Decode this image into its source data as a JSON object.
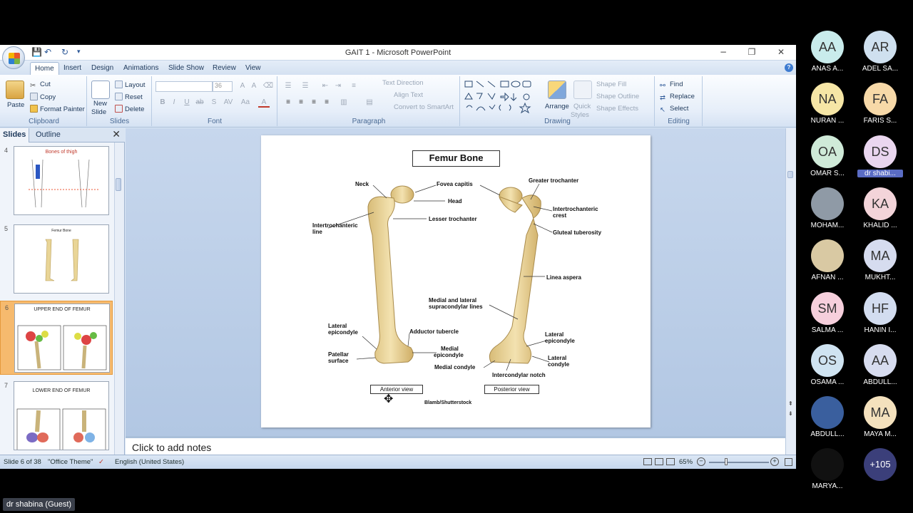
{
  "window": {
    "title": "GAIT 1 - Microsoft PowerPoint",
    "minimize": "−",
    "restore": "❐",
    "close": "✕"
  },
  "qat": {
    "save": "💾",
    "undo": "↶",
    "redo": "↻",
    "more": "▾"
  },
  "tabs": [
    "Home",
    "Insert",
    "Design",
    "Animations",
    "Slide Show",
    "Review",
    "View"
  ],
  "ribbon": {
    "clipboard": {
      "label": "Clipboard",
      "paste": "Paste",
      "cut": "Cut",
      "copy": "Copy",
      "format_painter": "Format Painter"
    },
    "slides": {
      "label": "Slides",
      "new_slide": "New",
      "new_slide2": "Slide",
      "layout": "Layout",
      "reset": "Reset",
      "delete": "Delete"
    },
    "font": {
      "label": "Font",
      "font_size": "36"
    },
    "paragraph": {
      "label": "Paragraph",
      "text_direction": "Text Direction",
      "align_text": "Align Text",
      "convert": "Convert to SmartArt"
    },
    "drawing": {
      "label": "Drawing",
      "arrange": "Arrange",
      "quick_styles": "Quick",
      "quick_styles2": "Styles",
      "shape_fill": "Shape Fill",
      "shape_outline": "Shape Outline",
      "shape_effects": "Shape Effects"
    },
    "editing": {
      "label": "Editing",
      "find": "Find",
      "replace": "Replace",
      "select": "Select"
    }
  },
  "panel": {
    "tab_slides": "Slides",
    "tab_outline": "Outline",
    "close": "✕",
    "thumbs": [
      {
        "num": "4",
        "title": "Bones of thigh"
      },
      {
        "num": "5",
        "title": "Femur Bone"
      },
      {
        "num": "6",
        "title": "UPPER END OF FEMUR"
      },
      {
        "num": "7",
        "title": "LOWER END OF FEMUR"
      }
    ]
  },
  "slide": {
    "title": "Femur Bone",
    "labels": {
      "neck": "Neck",
      "fovea": "Fovea capitis",
      "head": "Head",
      "greater_troch": "Greater trochanter",
      "intertroch_crest1": "Intertrochanteric",
      "intertroch_crest2": "crest",
      "intertroch_line1": "Intertrochanteric",
      "intertroch_line2": "line",
      "lesser_troch": "Lesser trochanter",
      "gluteal": "Gluteal tuberosity",
      "linea_aspera": "Linea aspera",
      "supracondylar1": "Medial and lateral",
      "supracondylar2": "supracondylar lines",
      "lat_epi_left1": "Lateral",
      "lat_epi_left2": "epicondyle",
      "adductor": "Adductor tubercle",
      "lat_epi_right1": "Lateral",
      "lat_epi_right2": "epicondyle",
      "patellar1": "Patellar",
      "patellar2": "surface",
      "med_epi1": "Medial",
      "med_epi2": "epicondyle",
      "lat_condyle1": "Lateral",
      "lat_condyle2": "condyle",
      "med_condyle": "Medial condyle",
      "intercondylar": "Intercondylar notch",
      "anterior": "Anterior view",
      "posterior": "Posterior view",
      "credit": "Blamb/Shutterstock"
    }
  },
  "notes": "Click to add notes",
  "status": {
    "slide_pos": "Slide 6 of 38",
    "theme": "\"Office Theme\"",
    "language": "English (United States)",
    "zoom": "65%"
  },
  "participants": [
    {
      "initials": "AA",
      "name": "ANAS A...",
      "color": "#c9ecec"
    },
    {
      "initials": "AR",
      "name": "ADEL SA...",
      "color": "#cfe0ef"
    },
    {
      "initials": "NA",
      "name": "NURAN ...",
      "color": "#f6e6a6"
    },
    {
      "initials": "FA",
      "name": "FARIS S...",
      "color": "#f7d9a8"
    },
    {
      "initials": "OA",
      "name": "OMAR S...",
      "color": "#cfead8"
    },
    {
      "initials": "DS",
      "name": "dr shabi...",
      "color": "#ead6ef"
    },
    {
      "initials": "",
      "name": "MOHAM...",
      "color": "#8f9aa6"
    },
    {
      "initials": "KA",
      "name": "KHALID ...",
      "color": "#f3d4d9"
    },
    {
      "initials": "",
      "name": "AFNAN ...",
      "color": "#d9c9a3"
    },
    {
      "initials": "MA",
      "name": "MUKHT...",
      "color": "#d6dcef"
    },
    {
      "initials": "SM",
      "name": "SALMA ...",
      "color": "#f6cfdc"
    },
    {
      "initials": "HF",
      "name": "HANIN I...",
      "color": "#d3ddf0"
    },
    {
      "initials": "OS",
      "name": "OSAMA ...",
      "color": "#cfe3f1"
    },
    {
      "initials": "AA",
      "name": "ABDULL...",
      "color": "#d7dcef"
    },
    {
      "initials": "",
      "name": "ABDULL...",
      "color": "#3a5f9e"
    },
    {
      "initials": "MA",
      "name": "MAYA M...",
      "color": "#f4e1bd"
    },
    {
      "initials": "",
      "name": "MARYA...",
      "color": "#111111"
    },
    {
      "initials": "+105",
      "name": "",
      "color": "#3b3f7a"
    }
  ],
  "guest": "dr shabina (Guest)"
}
